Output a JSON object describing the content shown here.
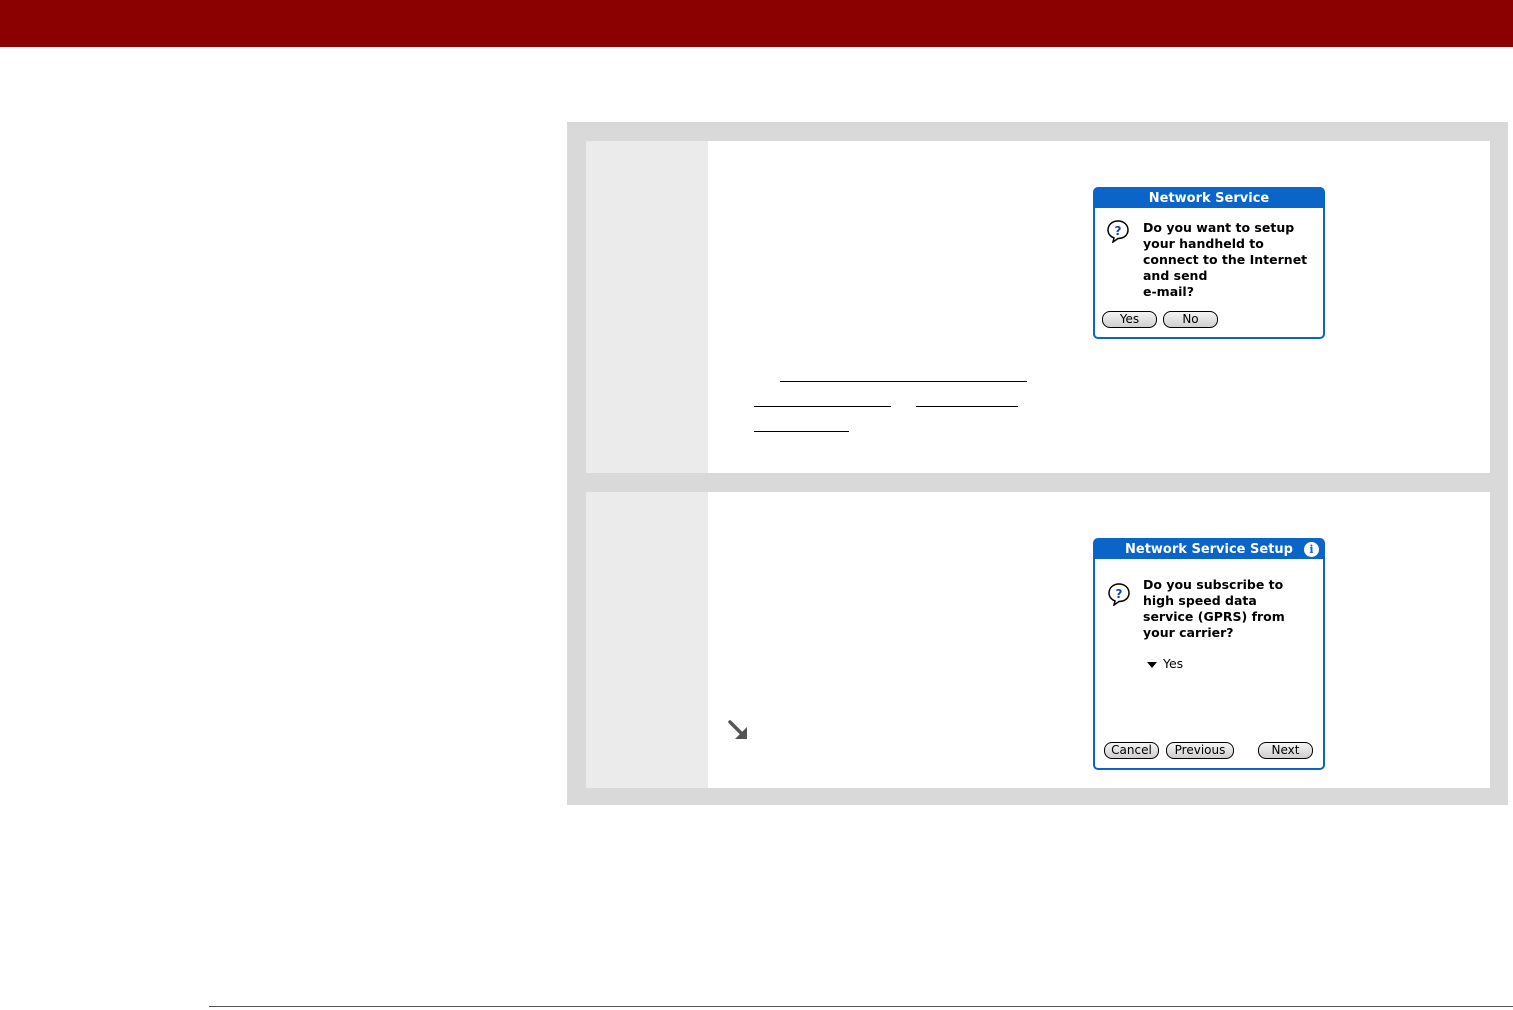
{
  "colors": {
    "header_band": "#8b0000",
    "dialog_blue": "#0b64c8",
    "panel_gray": "#d9d9d9"
  },
  "step1": {
    "dialog": {
      "title": "Network Service",
      "icon": "question-icon",
      "message": "Do you want to setup\nyour handheld to\nconnect to the Internet\nand send\ne-mail?",
      "buttons": [
        "Yes",
        "No"
      ]
    }
  },
  "step2": {
    "tip_icon": "tip-arrow-icon",
    "dialog": {
      "title": "Network Service Setup",
      "info_icon": "i",
      "icon": "question-icon",
      "message": "Do you subscribe to\nhigh speed data\nservice (GPRS) from\nyour carrier?",
      "dropdown_value": "Yes",
      "buttons": [
        "Cancel",
        "Previous",
        "Next"
      ]
    }
  }
}
